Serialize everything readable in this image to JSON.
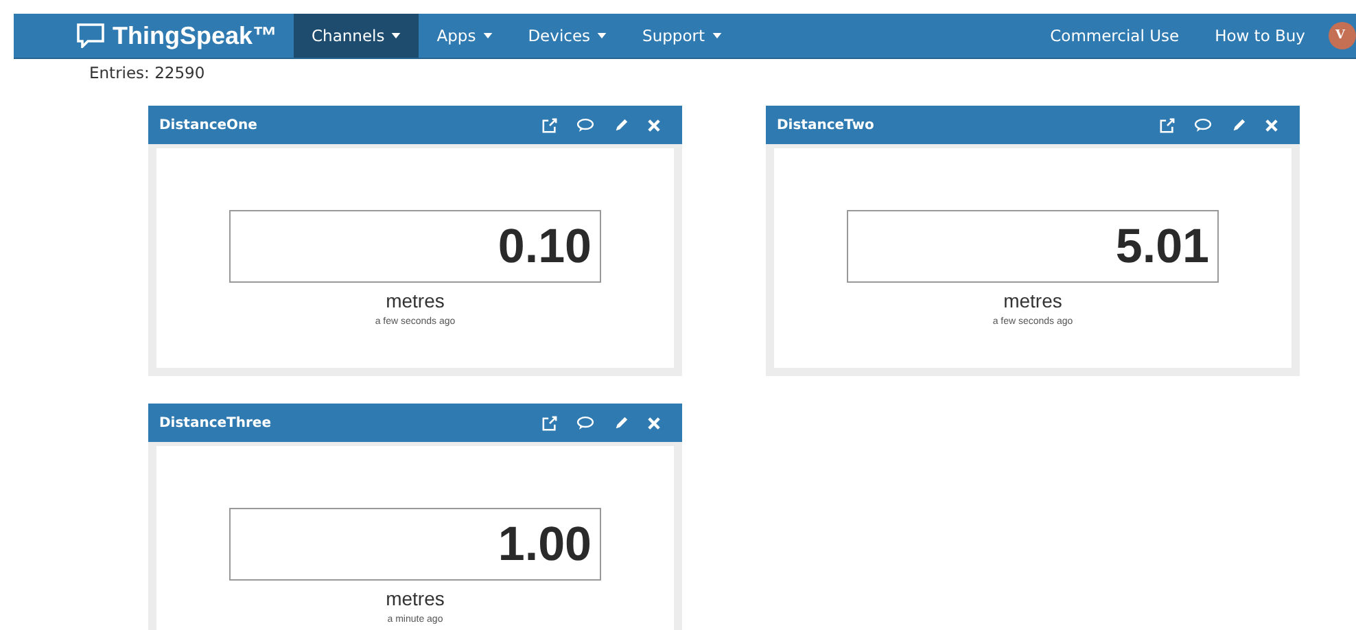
{
  "navbar": {
    "brand": "ThingSpeak™",
    "menus": [
      {
        "label": "Channels",
        "selected": true
      },
      {
        "label": "Apps",
        "selected": false
      },
      {
        "label": "Devices",
        "selected": false
      },
      {
        "label": "Support",
        "selected": false
      }
    ],
    "links": [
      "Commercial Use",
      "How to Buy"
    ],
    "avatar": "V"
  },
  "entries": "Entries: 22590",
  "widgets": [
    {
      "title": "DistanceOne",
      "value": "0.10",
      "unit": "metres",
      "updated": "a few seconds ago"
    },
    {
      "title": "DistanceTwo",
      "value": "5.01",
      "unit": "metres",
      "updated": "a few seconds ago"
    },
    {
      "title": "DistanceThree",
      "value": "1.00",
      "unit": "metres",
      "updated": "a minute ago"
    }
  ]
}
